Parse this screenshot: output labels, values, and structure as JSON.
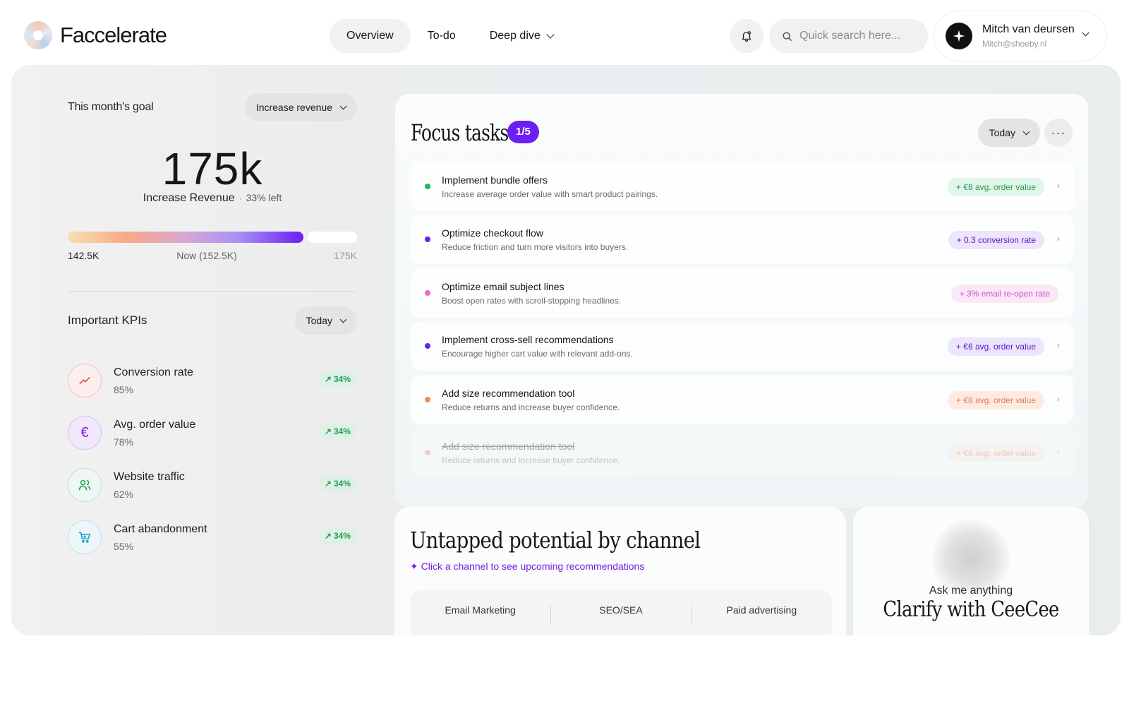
{
  "brand": {
    "name": "Faccelerate"
  },
  "nav": {
    "items": [
      {
        "label": "Overview",
        "active": true
      },
      {
        "label": "To-do",
        "active": false
      },
      {
        "label": "Deep dive",
        "active": false
      }
    ]
  },
  "search": {
    "placeholder": "Quick search here..."
  },
  "user": {
    "name": "Mitch van deursen",
    "email": "Mitch@shoeby.nl"
  },
  "goal": {
    "label": "This month's goal",
    "selector": "Increase revenue",
    "value": "175k",
    "name": "Increase Revenue",
    "remaining": "33% left",
    "progress": {
      "start_label": "142.5K",
      "now_label": "Now (152.5K)",
      "end_label": "175K",
      "start": 142.5,
      "now": 152.5,
      "end": 175,
      "bar_fill_fraction": 0.815
    }
  },
  "kpis": {
    "title": "Important KPIs",
    "period": "Today",
    "items": [
      {
        "name": "Conversion rate",
        "value": "85%",
        "change": "34%",
        "icon": "trend-line-icon",
        "color": "#e0413a"
      },
      {
        "name": "Avg. order value",
        "value": "78%",
        "change": "34%",
        "icon": "euro-icon",
        "color": "#7a1ae6"
      },
      {
        "name": "Website traffic",
        "value": "62%",
        "change": "34%",
        "icon": "users-icon",
        "color": "#1f9d55"
      },
      {
        "name": "Cart abandonment",
        "value": "55%",
        "change": "34%",
        "icon": "cart-icon",
        "color": "#1a9cc2"
      }
    ]
  },
  "focus": {
    "title": "Focus tasks",
    "count": "1/5",
    "period": "Today",
    "more": "···",
    "tasks": [
      {
        "title": "Implement bundle offers",
        "desc": "Increase average order value with smart product pairings.",
        "tag": "+ €8 avg. order value",
        "color": "#1fb862",
        "tag_bg": "#e1f5e8",
        "tag_color": "#1f9d55",
        "done": false
      },
      {
        "title": "Optimize checkout flow",
        "desc": "Reduce friction and turn more visitors into buyers.",
        "tag": "+ 0.3 conversion rate",
        "color": "#6b1ff4",
        "tag_bg": "#ece5fb",
        "tag_color": "#5a17c9",
        "done": false
      },
      {
        "title": "Optimize email subject lines",
        "desc": "Boost open rates with scroll-stopping headlines.",
        "tag": "+ 3% email re-open rate",
        "color": "#e66bd8",
        "tag_bg": "#fbe8f7",
        "tag_color": "#d04fc3",
        "done": false
      },
      {
        "title": "Implement cross-sell recommendations",
        "desc": "Encourage higher cart value with relevant add-ons.",
        "tag": "+ €6 avg. order value",
        "color": "#6b1ff4",
        "tag_bg": "#ece5fb",
        "tag_color": "#5a17c9",
        "done": false
      },
      {
        "title": "Add size recommendation tool",
        "desc": "Reduce returns and increase buyer confidence.",
        "tag": "+ €8 avg. order value",
        "color": "#f28b63",
        "tag_bg": "#fdebe2",
        "tag_color": "#e9794d",
        "done": false
      },
      {
        "title": "Add size recommendation tool",
        "desc": "Reduce returns and increase buyer confidence.",
        "tag": "+ €8 avg. order value",
        "color": "#f28b63",
        "tag_bg": "#fdebe2",
        "tag_color": "#e9794d",
        "done": true
      }
    ]
  },
  "untapped": {
    "title": "Untapped potential by channel",
    "hint": "✦ Click a channel to see upcoming recommendations",
    "channels": [
      "Email Marketing",
      "SEO/SEA",
      "Paid advertising"
    ]
  },
  "assistant": {
    "subtitle": "Ask me anything",
    "title": "Clarify with CeeCee"
  }
}
